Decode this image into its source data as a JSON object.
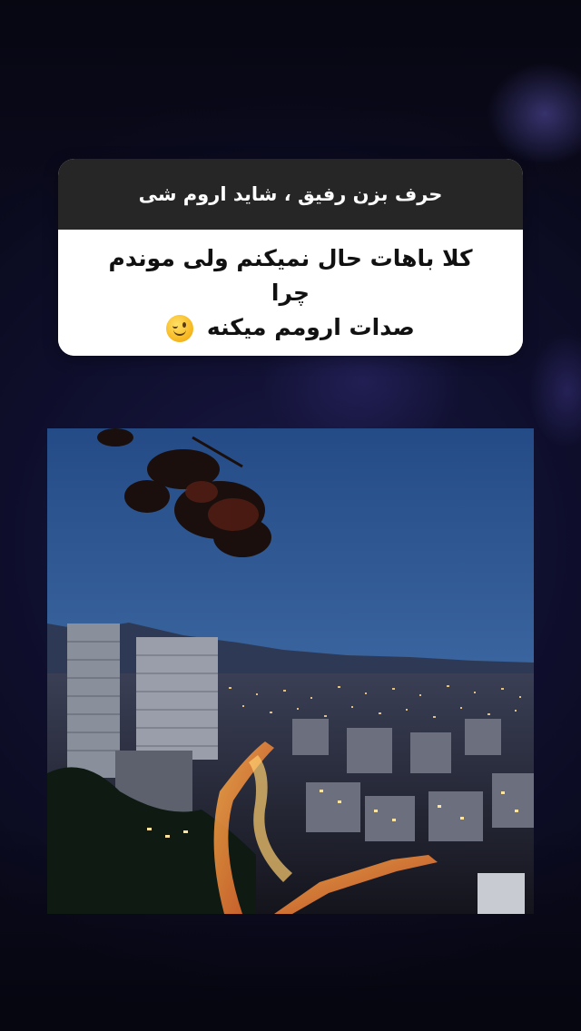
{
  "story": {
    "question_sticker": {
      "question": "حرف بزن رفیق ، شاید اروم شی",
      "answer_line1": "کلا باهات حال نمیکنم ولی موندم چرا",
      "answer_line2": "صدات ارومم میکنه",
      "answer_emoji": "winking-face-icon"
    },
    "photo": {
      "subject": "city-skyline-at-dusk"
    }
  },
  "colors": {
    "sticker_header": "#262626",
    "sticker_body": "#ffffff",
    "background": "#0f0f2e"
  }
}
